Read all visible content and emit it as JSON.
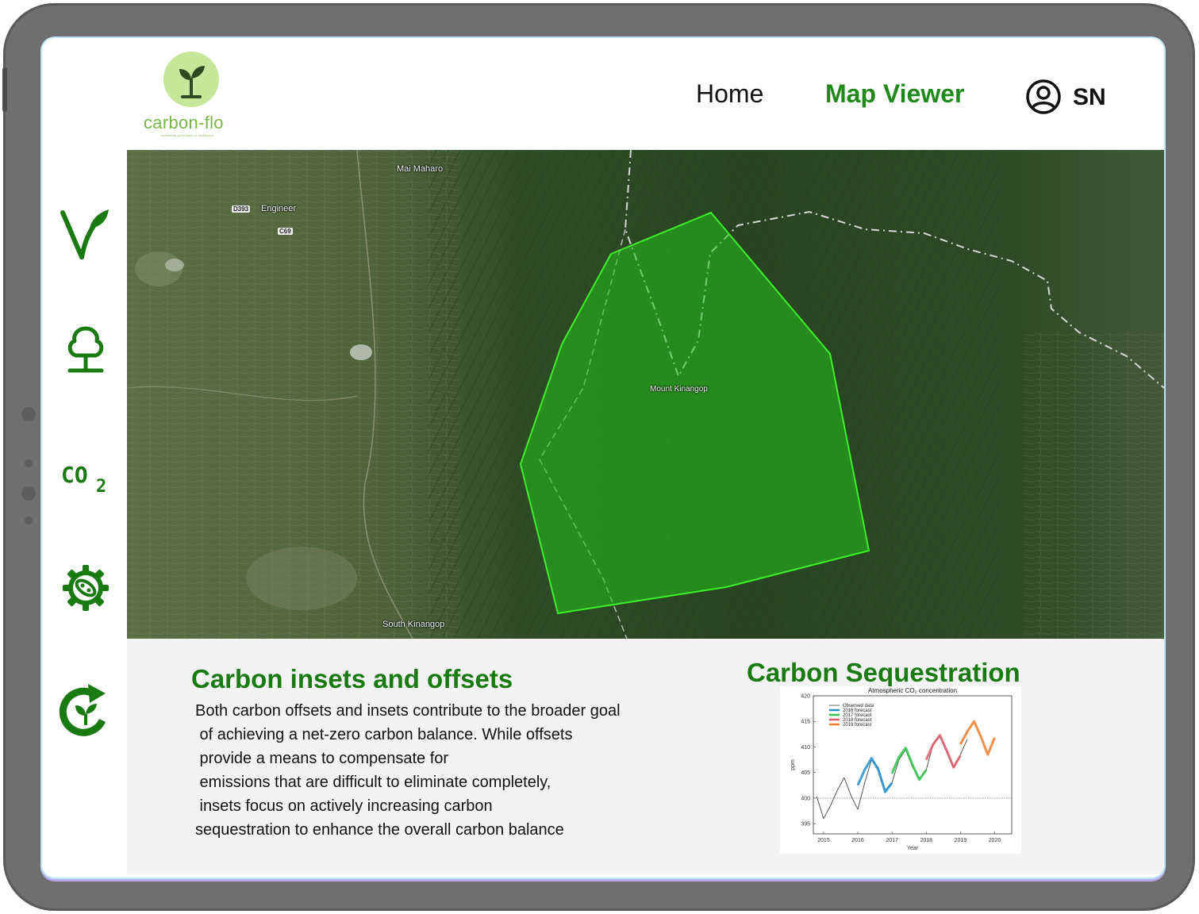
{
  "header": {
    "logo_text": "carbon-flo",
    "logo_tagline": "biodiversity geoinsights & intelligence",
    "nav": {
      "home": "Home",
      "map_viewer": "Map Viewer"
    },
    "user_initials": "SN"
  },
  "sidebar": {
    "items": [
      {
        "icon": "leaf-v-icon"
      },
      {
        "icon": "tree-icon"
      },
      {
        "icon": "co2-icon"
      },
      {
        "icon": "microbe-gear-icon"
      },
      {
        "icon": "recycle-leaf-icon"
      }
    ]
  },
  "map": {
    "labels": {
      "mai_maharo": "Mai Maharo",
      "engineer": "Engineer",
      "road_d393": "D393",
      "road_c69": "C69",
      "mount_kinangop": "Mount Kinangop",
      "south_kinangop": "South Kinangop"
    },
    "colors": {
      "polygon_fill": "#22c41a",
      "polygon_stroke": "#3cf02a"
    }
  },
  "info": {
    "title": "Carbon insets and offsets",
    "body_lines": [
      "Both carbon offsets and insets contribute to the broader goal",
      " of achieving a net-zero carbon balance. While offsets",
      " provide a means to compensate for",
      " emissions that are difficult to eliminate completely,",
      " insets focus on actively increasing carbon",
      "sequestration to enhance the overall carbon balance"
    ],
    "sequestration_title": "Carbon Sequestration"
  },
  "chart_data": {
    "type": "line",
    "title": "Atmospheric CO₂ concentration",
    "xlabel": "Year",
    "ylabel": "ppm",
    "xlim": [
      2014.7,
      2020.5
    ],
    "ylim": [
      393,
      420
    ],
    "x_ticks": [
      "2015",
      "2016",
      "2017",
      "2018",
      "2019",
      "2020"
    ],
    "y_ticks": [
      "395",
      "400",
      "405",
      "410",
      "415",
      "420"
    ],
    "reference_line": 400,
    "legend": [
      "Observed data",
      "2016 forecast",
      "2017 forecast",
      "2018 forecast",
      "2019 forecast"
    ],
    "legend_position": "top-left",
    "series": [
      {
        "name": "Observed data",
        "color": "#444444",
        "x": [
          2014.8,
          2015.0,
          2015.2,
          2015.4,
          2015.6,
          2015.8,
          2016.0,
          2016.2,
          2016.4,
          2016.6,
          2016.8,
          2017.0,
          2017.2,
          2017.4,
          2017.6,
          2017.8,
          2018.0,
          2018.2,
          2018.4,
          2018.6,
          2018.8,
          2019.0,
          2019.2
        ],
        "y": [
          400.3,
          396.0,
          398.5,
          401.5,
          404.0,
          400.5,
          397.8,
          403.0,
          407.5,
          406.0,
          401.5,
          403.0,
          407.5,
          409.5,
          406.0,
          403.8,
          405.5,
          410.5,
          412.0,
          409.0,
          406.0,
          408.5,
          411.5
        ]
      },
      {
        "name": "2016 forecast",
        "color": "#1f8fd0",
        "x": [
          2016.0,
          2016.2,
          2016.4,
          2016.6,
          2016.8,
          2017.0
        ],
        "y": [
          402.5,
          405.5,
          407.8,
          405.5,
          401.2,
          403.0
        ]
      },
      {
        "name": "2017 forecast",
        "color": "#2ec24a",
        "x": [
          2017.0,
          2017.2,
          2017.4,
          2017.6,
          2017.8,
          2018.0
        ],
        "y": [
          404.8,
          408.0,
          409.8,
          406.5,
          403.6,
          405.5
        ]
      },
      {
        "name": "2018 forecast",
        "color": "#e25a6a",
        "x": [
          2018.0,
          2018.2,
          2018.4,
          2018.6,
          2018.8,
          2019.0
        ],
        "y": [
          407.5,
          410.5,
          412.3,
          409.3,
          406.0,
          408.3
        ]
      },
      {
        "name": "2019 forecast",
        "color": "#f07a2a",
        "x": [
          2019.0,
          2019.2,
          2019.4,
          2019.6,
          2019.8,
          2020.0
        ],
        "y": [
          410.5,
          413.0,
          415.0,
          412.0,
          408.5,
          411.8
        ]
      }
    ]
  }
}
